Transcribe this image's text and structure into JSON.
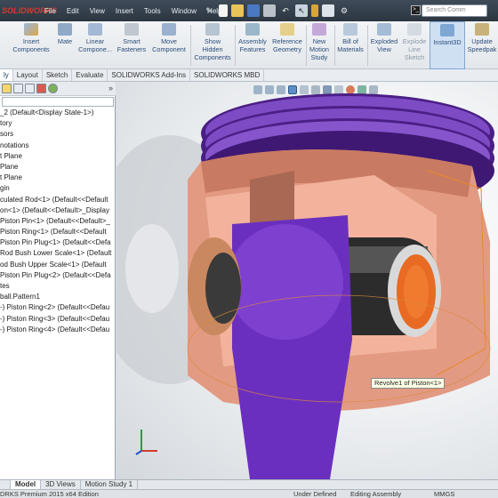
{
  "app": {
    "logo_text": "SOLIDWORKS",
    "brand_color": "#d23b2f"
  },
  "menu": [
    "File",
    "Edit",
    "View",
    "Insert",
    "Tools",
    "Window",
    "Help"
  ],
  "search": {
    "placeholder": "Search Comm"
  },
  "commands": [
    {
      "label": "Insert\nComponents",
      "icon": "insert-components-icon",
      "disabled": false
    },
    {
      "label": "Mate",
      "icon": "mate-icon",
      "disabled": false
    },
    {
      "label": "Linear\nCompone...",
      "icon": "linear-pattern-icon",
      "disabled": false
    },
    {
      "label": "Smart\nFasteners",
      "icon": "smart-fasteners-icon",
      "disabled": false
    },
    {
      "label": "Move\nComponent",
      "icon": "move-component-icon",
      "disabled": false
    },
    {
      "label": "Show\nHidden\nComponents",
      "icon": "show-hidden-icon",
      "disabled": false
    },
    {
      "label": "Assembly\nFeatures",
      "icon": "assembly-features-icon",
      "disabled": false
    },
    {
      "label": "Reference\nGeometry",
      "icon": "reference-geometry-icon",
      "disabled": false
    },
    {
      "label": "New\nMotion\nStudy",
      "icon": "motion-study-icon",
      "disabled": false
    },
    {
      "label": "Bill of\nMaterials",
      "icon": "bom-icon",
      "disabled": false
    },
    {
      "label": "Exploded\nView",
      "icon": "exploded-view-icon",
      "disabled": false
    },
    {
      "label": "Explode\nLine\nSketch",
      "icon": "explode-line-icon",
      "disabled": true
    },
    {
      "label": "Instant3D",
      "icon": "instant3d-icon",
      "disabled": false,
      "active": true
    },
    {
      "label": "Update\nSpeedpak",
      "icon": "speedpak-icon",
      "disabled": false
    }
  ],
  "tabs": [
    "ly",
    "Layout",
    "Sketch",
    "Evaluate",
    "SOLIDWORKS Add-Ins",
    "SOLIDWORKS MBD"
  ],
  "tree": [
    "_2  (Default<Display State-1>)",
    "tory",
    "sors",
    "notations",
    "t Plane",
    "Plane",
    "t Plane",
    "gin",
    "culated Rod<1> (Default<<Default",
    "on<1> (Default<<Default>_Display",
    "Piston Pin<1> (Default<<Default>_",
    "Piston Ring<1> (Default<<Default",
    "Piston Pin Plug<1> (Default<<Defa",
    "Rod Bush Lower Scale<1> (Default",
    "od Bush Upper Scale<1> (Default",
    "Piston Pin Plug<2> (Default<<Defa",
    "tes",
    "ball.Pattern1",
    "-) Piston Ring<2> (Default<<Defau",
    "-) Piston Ring<3> (Default<<Defau",
    "-) Piston Ring<4> (Default<<Defau"
  ],
  "tooltip": "Revolve1 of Piston<1>",
  "bottom_tabs": [
    "Model",
    "3D Views",
    "Motion Study 1"
  ],
  "status": {
    "edition": "DRKS Premium 2015 x64 Edition",
    "state": "Under Defined",
    "mode": "Editing Assembly",
    "units": "MMGS"
  }
}
